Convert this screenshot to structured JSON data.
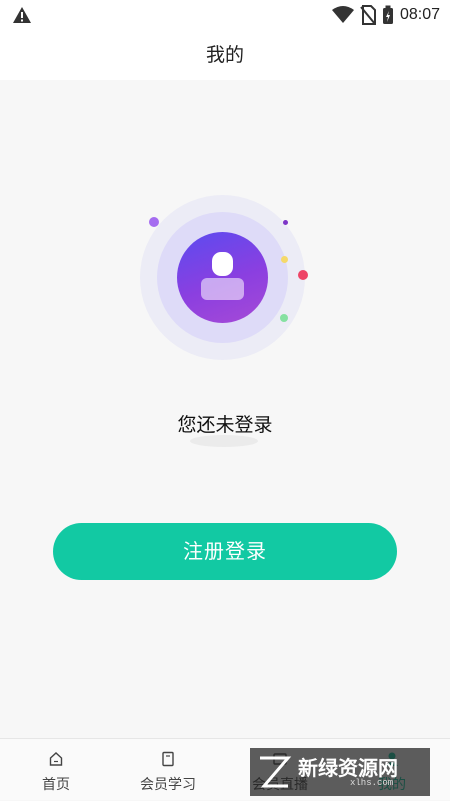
{
  "status_bar": {
    "time": "08:07",
    "icons": [
      "warning-icon",
      "wifi-icon",
      "no-sim-icon",
      "battery-charging-icon"
    ]
  },
  "header": {
    "title": "我的"
  },
  "profile": {
    "avatar_icon": "user-avatar-icon",
    "not_logged_in_text": "您还未登录",
    "login_button_label": "注册登录"
  },
  "tabs": [
    {
      "label": "首页",
      "icon": "home-icon",
      "active": false
    },
    {
      "label": "会员学习",
      "icon": "book-icon",
      "active": false
    },
    {
      "label": "会员直播",
      "icon": "live-tv-icon",
      "active": false
    },
    {
      "label": "我的",
      "icon": "profile-icon",
      "active": true
    }
  ],
  "watermark": {
    "text": "新绿资源网",
    "sub": "xlhs.com"
  },
  "colors": {
    "accent": "#12c9a3",
    "avatar_gradient_start": "#5b4bf0",
    "avatar_gradient_end": "#a64ad6",
    "background": "#f7f7f7"
  }
}
